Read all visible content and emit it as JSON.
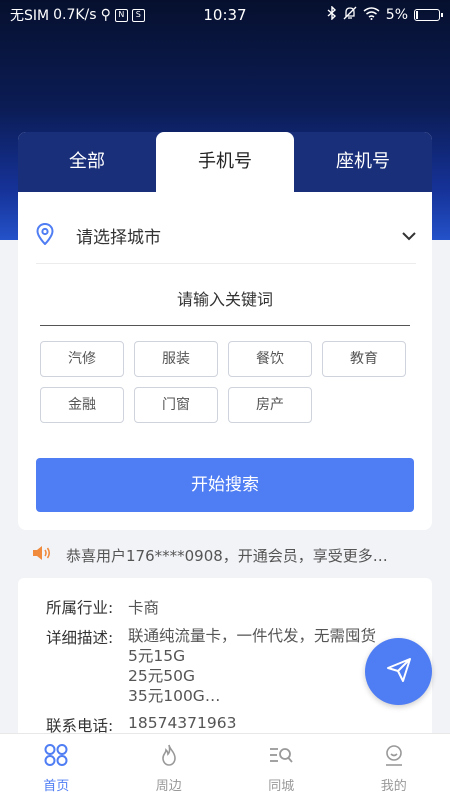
{
  "status_bar": {
    "carrier": "无SIM",
    "speed": "0.7K/s",
    "box_a": "N",
    "box_b": "S",
    "time": "10:37",
    "battery": "5%",
    "battery_level": 0.05
  },
  "tabs": [
    {
      "label": "全部",
      "active": false
    },
    {
      "label": "手机号",
      "active": true
    },
    {
      "label": "座机号",
      "active": false
    }
  ],
  "city_select": {
    "label": "请选择城市",
    "icon": "location-pin-icon"
  },
  "keyword_input": {
    "placeholder": "请输入关键词"
  },
  "categories": [
    "汽修",
    "服装",
    "餐饮",
    "教育",
    "金融",
    "门窗",
    "房产"
  ],
  "search_button": {
    "label": "开始搜索"
  },
  "notice": {
    "icon": "speaker-icon",
    "text": "恭喜用户176****0908，开通会员，享受更多…"
  },
  "result": {
    "industry_label": "所属行业:",
    "industry_value": "卡商",
    "desc_label": "详细描述:",
    "desc_lines": [
      "联通纯流量卡，一件代发，无需囤货",
      "5元15G",
      "25元50G",
      "35元100G…"
    ],
    "phone_label": "联系电话:",
    "phone_value": "18574371963"
  },
  "fab": {
    "icon": "send-icon"
  },
  "bottom_nav": [
    {
      "label": "首页",
      "icon": "home-grid-icon",
      "active": true
    },
    {
      "label": "周边",
      "icon": "flame-icon",
      "active": false
    },
    {
      "label": "同城",
      "icon": "list-search-icon",
      "active": false
    },
    {
      "label": "我的",
      "icon": "user-icon",
      "active": false
    }
  ],
  "colors": {
    "accent": "#4f7df3",
    "hero_dark": "#06102e",
    "hero_light": "#2452c9"
  }
}
